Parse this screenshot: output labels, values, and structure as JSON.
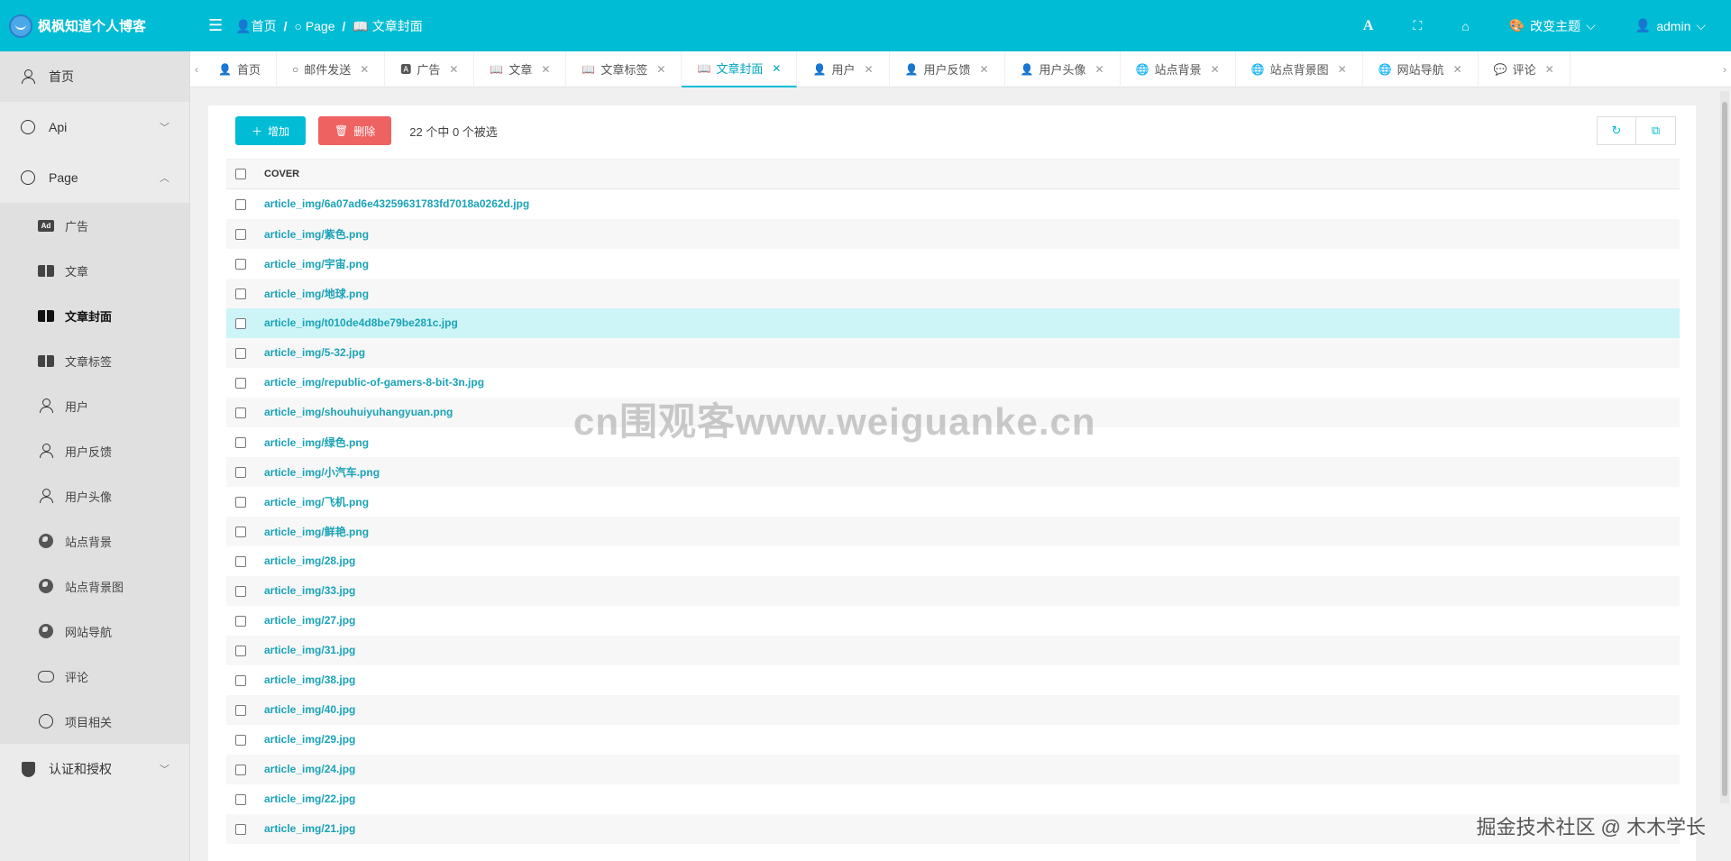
{
  "header": {
    "site_title": "枫枫知道个人博客",
    "breadcrumbs": [
      "首页",
      "Page",
      "文章封面"
    ],
    "change_theme": "改变主题",
    "user": "admin"
  },
  "sidebar": {
    "home": "首页",
    "api": "Api",
    "page": "Page",
    "items": [
      {
        "label": "广告",
        "icon": "ad-icon"
      },
      {
        "label": "文章",
        "icon": "book-icon"
      },
      {
        "label": "文章封面",
        "icon": "book-icon"
      },
      {
        "label": "文章标签",
        "icon": "book-icon"
      },
      {
        "label": "用户",
        "icon": "user-icon"
      },
      {
        "label": "用户反馈",
        "icon": "user-icon"
      },
      {
        "label": "用户头像",
        "icon": "user-icon"
      },
      {
        "label": "站点背景",
        "icon": "globe-icon"
      },
      {
        "label": "站点背景图",
        "icon": "globe-icon"
      },
      {
        "label": "网站导航",
        "icon": "globe-icon"
      },
      {
        "label": "评论",
        "icon": "comment-icon"
      },
      {
        "label": "项目相关",
        "icon": "circle-icon"
      }
    ],
    "auth": "认证和授权"
  },
  "tabs": [
    "首页",
    "邮件发送",
    "广告",
    "文章",
    "文章标签",
    "文章封面",
    "用户",
    "用户反馈",
    "用户头像",
    "站点背景",
    "站点背景图",
    "网站导航",
    "评论"
  ],
  "toolbar": {
    "add": "增加",
    "delete": "删除",
    "selection": "22 个中 0 个被选"
  },
  "table": {
    "header": "COVER",
    "rows": [
      "article_img/6a07ad6e43259631783fd7018a0262d.jpg",
      "article_img/紫色.png",
      "article_img/宇宙.png",
      "article_img/地球.png",
      "article_img/t010de4d8be79be281c.jpg",
      "article_img/5-32.jpg",
      "article_img/republic-of-gamers-8-bit-3n.jpg",
      "article_img/shouhuiyuhangyuan.png",
      "article_img/绿色.png",
      "article_img/小汽车.png",
      "article_img/飞机.png",
      "article_img/鲜艳.png",
      "article_img/28.jpg",
      "article_img/33.jpg",
      "article_img/27.jpg",
      "article_img/31.jpg",
      "article_img/38.jpg",
      "article_img/40.jpg",
      "article_img/29.jpg",
      "article_img/24.jpg",
      "article_img/22.jpg",
      "article_img/21.jpg"
    ]
  },
  "watermark": "cn围观客www.weiguanke.cn",
  "footer_watermark": "掘金技术社区 @ 木木学长",
  "colors": {
    "accent": "#00bcd4",
    "delete": "#ef6262",
    "link": "#1aa3b7",
    "highlight_row": "#cdf5f8"
  }
}
